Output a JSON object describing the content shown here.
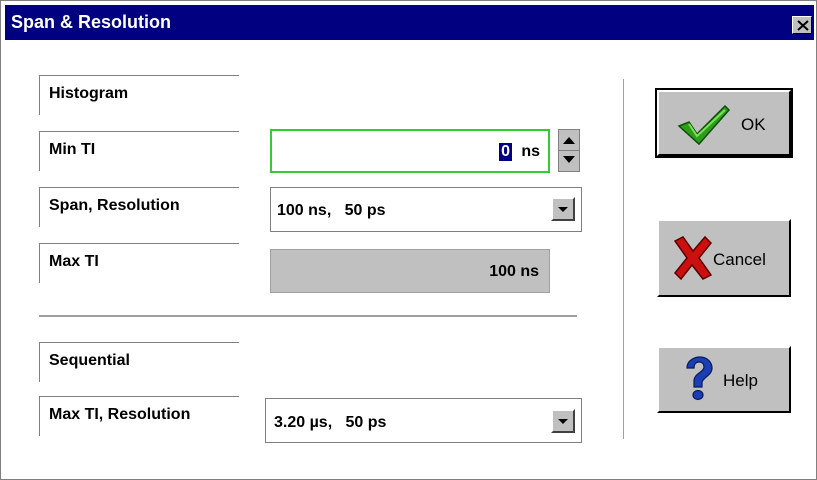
{
  "window": {
    "title": "Span & Resolution",
    "close_label": "close"
  },
  "histogram": {
    "section_label": "Histogram",
    "min_ti": {
      "label": "Min TI",
      "value_highlight": "0",
      "unit": "ns"
    },
    "span_resolution": {
      "label": "Span, Resolution",
      "selected": "100 ns,   50 ps"
    },
    "max_ti": {
      "label": "Max TI",
      "value": "100 ns"
    }
  },
  "sequential": {
    "section_label": "Sequential",
    "max_ti_resolution": {
      "label": "Max TI, Resolution",
      "selected": "3.20 µs,   50 ps"
    }
  },
  "buttons": {
    "ok": "OK",
    "cancel": "Cancel",
    "help": "Help"
  },
  "colors": {
    "titlebar": "#000080",
    "active_field_border": "#33cc33",
    "button_face": "#c0c0c0",
    "ok_check": "#2e9e1a",
    "cancel_x": "#cc1010",
    "help_q": "#1a3fb5"
  }
}
